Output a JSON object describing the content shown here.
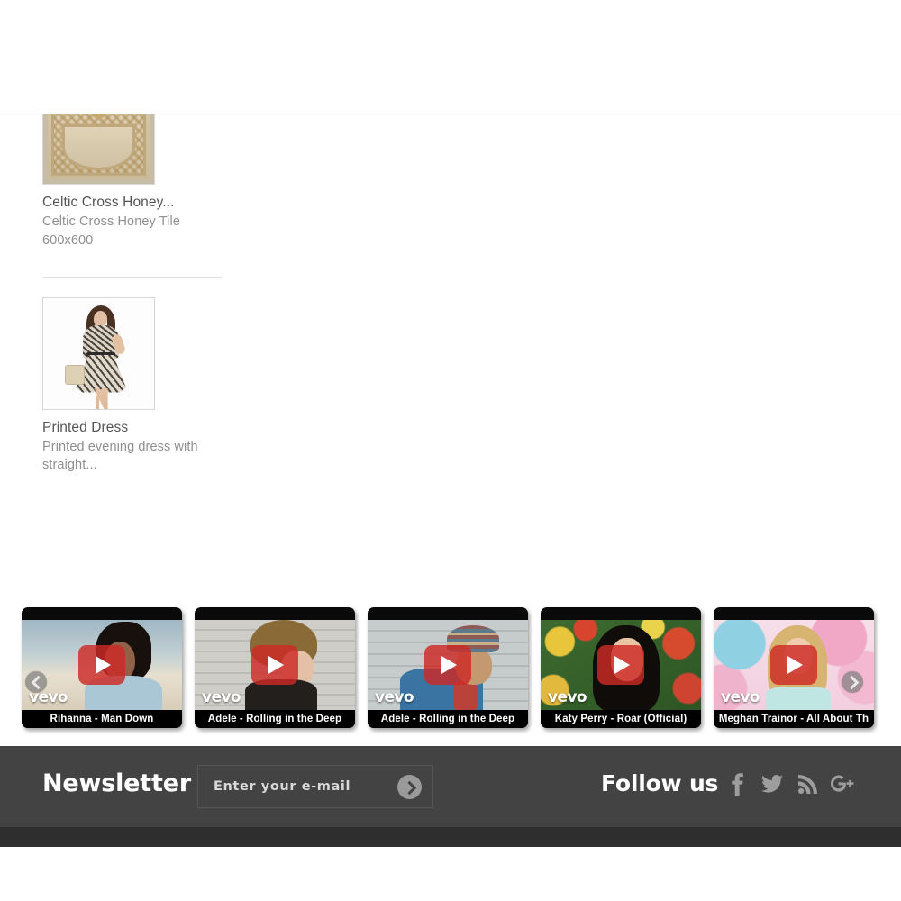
{
  "products": [
    {
      "title": "Celtic Cross Honey...",
      "description": "Celtic Cross Honey Tile 600x600",
      "image_name": "celtic-cross-honey-tile-thumbnail"
    },
    {
      "title": "Printed Dress",
      "description": "Printed evening dress with straight...",
      "image_name": "printed-dress-thumbnail"
    }
  ],
  "video_carousel": {
    "prev_label": "‹",
    "next_label": "›",
    "watermark": "vevo",
    "videos": [
      {
        "caption": "Rihanna - Man Down",
        "still": "still-rihanna"
      },
      {
        "caption": "Adele - Rolling in the Deep",
        "still": "still-adele1"
      },
      {
        "caption": "Adele - Rolling in the Deep",
        "still": "still-adele2"
      },
      {
        "caption": "Katy Perry - Roar (Official)",
        "still": "still-katy"
      },
      {
        "caption": "Meghan Trainor - All About Th",
        "still": "still-meghan"
      }
    ]
  },
  "footer": {
    "newsletter_title": "Newsletter",
    "newsletter_placeholder": "Enter your e-mail",
    "newsletter_value": "",
    "follow_title": "Follow us",
    "social": [
      {
        "name": "facebook-icon",
        "glyph": "f"
      },
      {
        "name": "twitter-icon",
        "glyph": "t"
      },
      {
        "name": "rss-icon",
        "glyph": "r"
      },
      {
        "name": "google-plus-icon",
        "glyph": "g+"
      }
    ]
  },
  "colors": {
    "footer_top": "#434343",
    "footer_bottom": "#2e2e2e",
    "play_red": "#cd2a26",
    "product_title": "#555555",
    "product_desc": "#8f8f8f",
    "divider": "#c9c9c9"
  }
}
